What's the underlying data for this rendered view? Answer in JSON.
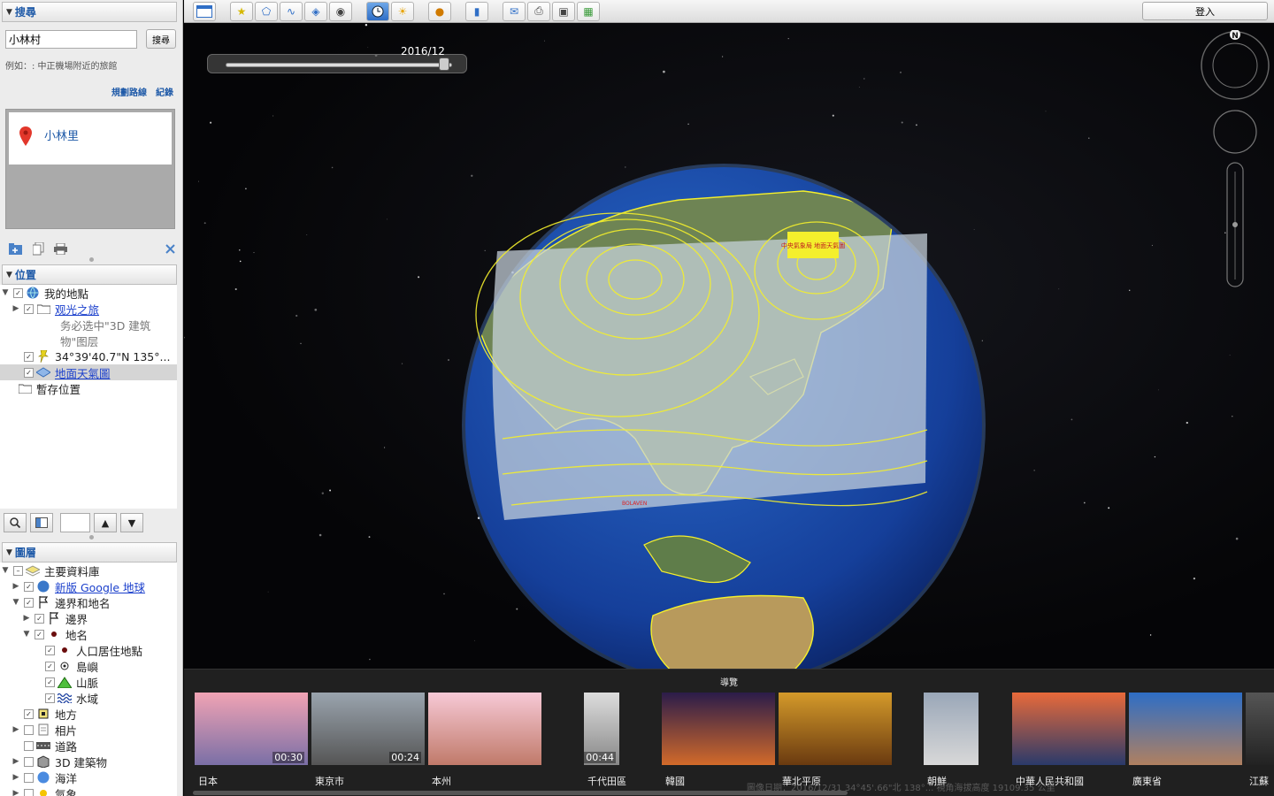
{
  "search": {
    "header": "搜尋",
    "query": "小林村",
    "button": "搜尋",
    "hint": "例如：: 中正機場附近的旅館",
    "link_directions": "規劃路線",
    "link_history": "紀錄",
    "result": "小林里"
  },
  "places": {
    "header": "位置",
    "items": [
      {
        "label": "我的地點"
      },
      {
        "label": "观光之旅"
      },
      {
        "label": "务必选中\"3D 建筑"
      },
      {
        "label": "物\"图层"
      },
      {
        "label": "34°39'40.7\"N 135°..."
      },
      {
        "label": "地面天氣圖"
      },
      {
        "label": "暫存位置"
      }
    ]
  },
  "layers": {
    "header": "圖層",
    "items": [
      {
        "label": "主要資料庫"
      },
      {
        "label": "新版 Google 地球"
      },
      {
        "label": "邊界和地名"
      },
      {
        "label": "邊界"
      },
      {
        "label": "地名"
      },
      {
        "label": "人口居住地點"
      },
      {
        "label": "島嶼"
      },
      {
        "label": "山脈"
      },
      {
        "label": "水域"
      },
      {
        "label": "地方"
      },
      {
        "label": "相片"
      },
      {
        "label": "道路"
      },
      {
        "label": "3D 建築物"
      },
      {
        "label": "海洋"
      },
      {
        "label": "氣象"
      }
    ]
  },
  "toolbar": {
    "signin": "登入"
  },
  "viewport": {
    "time_label": "2016/12",
    "compass_letter": "N",
    "timeline_position": 0.98,
    "overlay_stamp": "中央氣象局 地面天氣圖",
    "storm_label": "BOLAVEN"
  },
  "tour": {
    "title": "導覽",
    "status": "圖像日期：2016/12/31     34°45'.66\"北 138°... 視角海拔高度 19109.35 公里",
    "items": [
      {
        "label": "日本",
        "duration": "00:30"
      },
      {
        "label": "東京市",
        "duration": "00:24"
      },
      {
        "label": "本州",
        "duration": ""
      },
      {
        "label": "千代田區",
        "duration": "00:44"
      },
      {
        "label": "韓國",
        "duration": ""
      },
      {
        "label": "華北平原",
        "duration": ""
      },
      {
        "label": "朝鮮",
        "duration": ""
      },
      {
        "label": "中華人民共和國",
        "duration": ""
      },
      {
        "label": "廣東省",
        "duration": ""
      },
      {
        "label": "江蘇",
        "duration": ""
      }
    ]
  },
  "colors": {
    "accent": "#1f5aa8",
    "link": "#1a3fcc",
    "contour": "#f4ef2c",
    "ocean": "#1a4aa8"
  }
}
